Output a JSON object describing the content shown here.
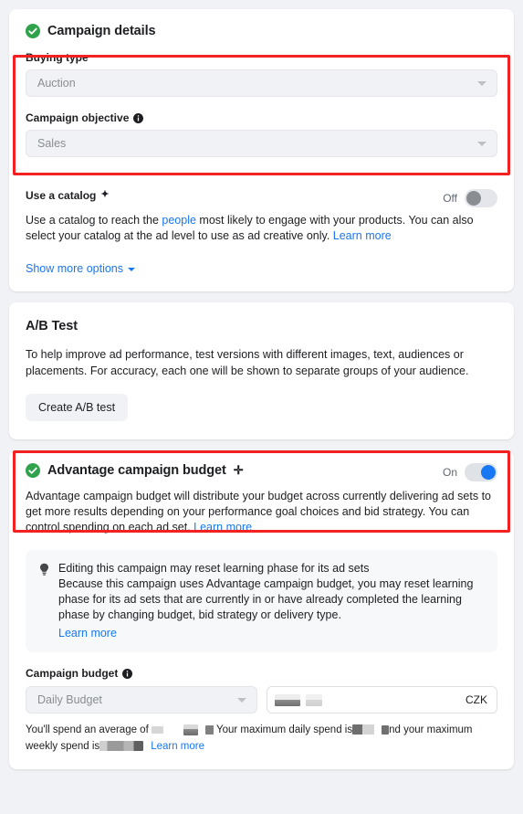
{
  "campaign_details": {
    "title": "Campaign details",
    "status_icon": "green-check-icon",
    "buying_type": {
      "label": "Buying type",
      "value": "Auction",
      "caret_icon": "chevron-down-icon"
    },
    "campaign_objective": {
      "label": "Campaign objective",
      "info_icon": "info-icon",
      "value": "Sales",
      "caret_icon": "chevron-down-icon"
    },
    "catalog": {
      "label": "Use a catalog",
      "sparkle_icon": "sparkle-icon",
      "sparkle_glyph": "✦",
      "toggle_state": "Off",
      "toggle_on": false,
      "description_part1": "Use a catalog to reach the ",
      "description_link1": "people",
      "description_part2": " most likely to engage with your products. You can also select your catalog at the ad level to use as ad creative only. ",
      "description_link2": "Learn more"
    },
    "show_more_options": "Show more options"
  },
  "ab_test": {
    "title": "A/B Test",
    "description": "To help improve ad performance, test versions with different images, text, audiences or placements. For accuracy, each one will be shown to separate groups of your audience.",
    "create_button": "Create A/B test"
  },
  "advantage_budget": {
    "title": "Advantage campaign budget",
    "status_icon": "green-check-icon",
    "plus_glyph": "✛",
    "toggle_state": "On",
    "toggle_on": true,
    "description": "Advantage campaign budget will distribute your budget across currently delivering ad sets to get more results depending on your performance goal choices and bid strategy. You can control spending on each ad set. ",
    "description_link": "Learn more",
    "notice": {
      "icon": "lightbulb-icon",
      "title": "Editing this campaign may reset learning phase for its ad sets",
      "body": "Because this campaign uses Advantage campaign budget, you may reset learning phase for its ad sets that are currently in or have already completed the learning phase by changing budget, bid strategy or delivery type.",
      "link": "Learn more"
    },
    "budget": {
      "label": "Campaign budget",
      "info_icon": "info-icon",
      "type_value": "Daily Budget",
      "caret_icon": "chevron-down-icon",
      "amount_value": "",
      "currency": "CZK"
    },
    "spend_note": {
      "part1": "You'll spend an average of ",
      "part2": " Your maximum daily spend is",
      "part3": "nd your maximum weekly spend is",
      "link": "Learn more"
    }
  },
  "colors": {
    "page_background": "#f0f2f5",
    "card_background": "#ffffff",
    "highlight_border": "#f32121",
    "accent_link": "#1877f2",
    "success_green": "#31a24c",
    "toggle_on": "#1877f2",
    "toggle_off_knob": "#8a8d91",
    "text_primary": "#1c1e21",
    "text_muted": "#8a8d91"
  },
  "highlights": [
    {
      "name": "buying-type-objective-highlight"
    },
    {
      "name": "advantage-campaign-budget-highlight"
    }
  ]
}
